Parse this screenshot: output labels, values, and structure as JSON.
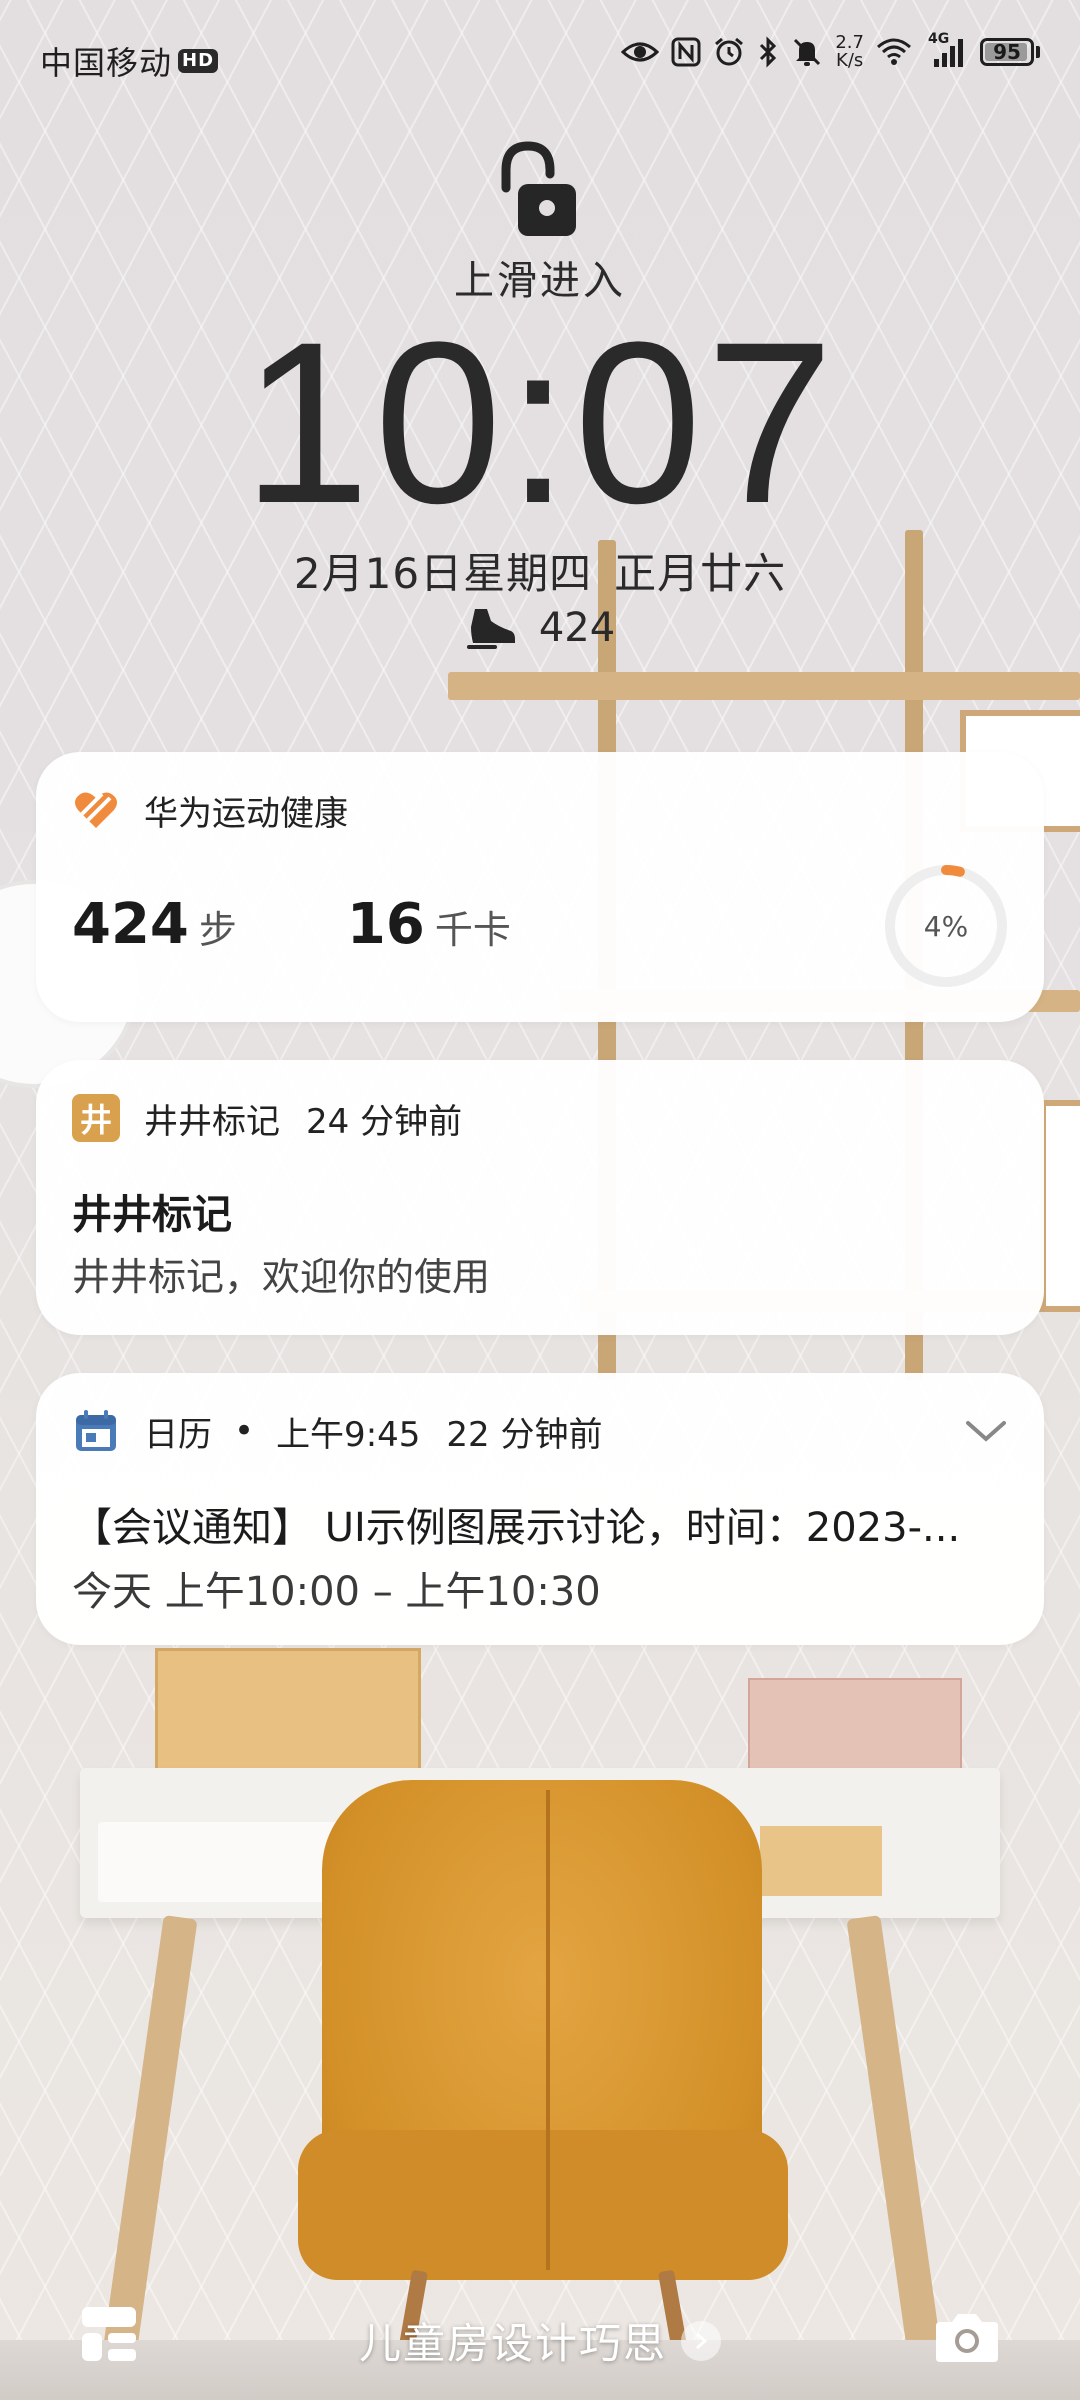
{
  "status_bar": {
    "carrier": "中国移动",
    "hd_badge": "HD",
    "net_speed_value": "2.7",
    "net_speed_unit": "K/s",
    "network_type": "4G",
    "battery_level": 95,
    "battery_text": "95",
    "icons": [
      "eye-icon",
      "nfc-icon",
      "alarm-icon",
      "bluetooth-icon",
      "mute-bell-icon",
      "wifi-icon",
      "signal-icon",
      "battery-icon"
    ]
  },
  "lock": {
    "swipe_hint": "上滑进入",
    "time": "10:07",
    "date": "2月16日星期四",
    "lunar_date": "正月廿六",
    "steps": "424"
  },
  "health_card": {
    "app_name": "华为运动健康",
    "steps_value": "424",
    "steps_unit": "步",
    "calories_value": "16",
    "calories_unit": "千卡",
    "progress_percent": 4,
    "progress_label": "4%",
    "accent_color": "#f08a3c"
  },
  "jingjing_card": {
    "icon_char": "井",
    "app_name": "井井标记",
    "time_ago": "24 分钟前",
    "title": "井井标记",
    "body": "井井标记，欢迎你的使用"
  },
  "calendar_card": {
    "app_name": "日历",
    "dot": "•",
    "time": "上午9:45",
    "time_ago": "22 分钟前",
    "title": "【会议通知】 UI示例图展示讨论，时间：2023-...",
    "body": "今天 上午10:00 – 上午10:30",
    "accent_color": "#4a7ab8"
  },
  "bottom": {
    "magazine_title": "儿童房设计巧思"
  }
}
